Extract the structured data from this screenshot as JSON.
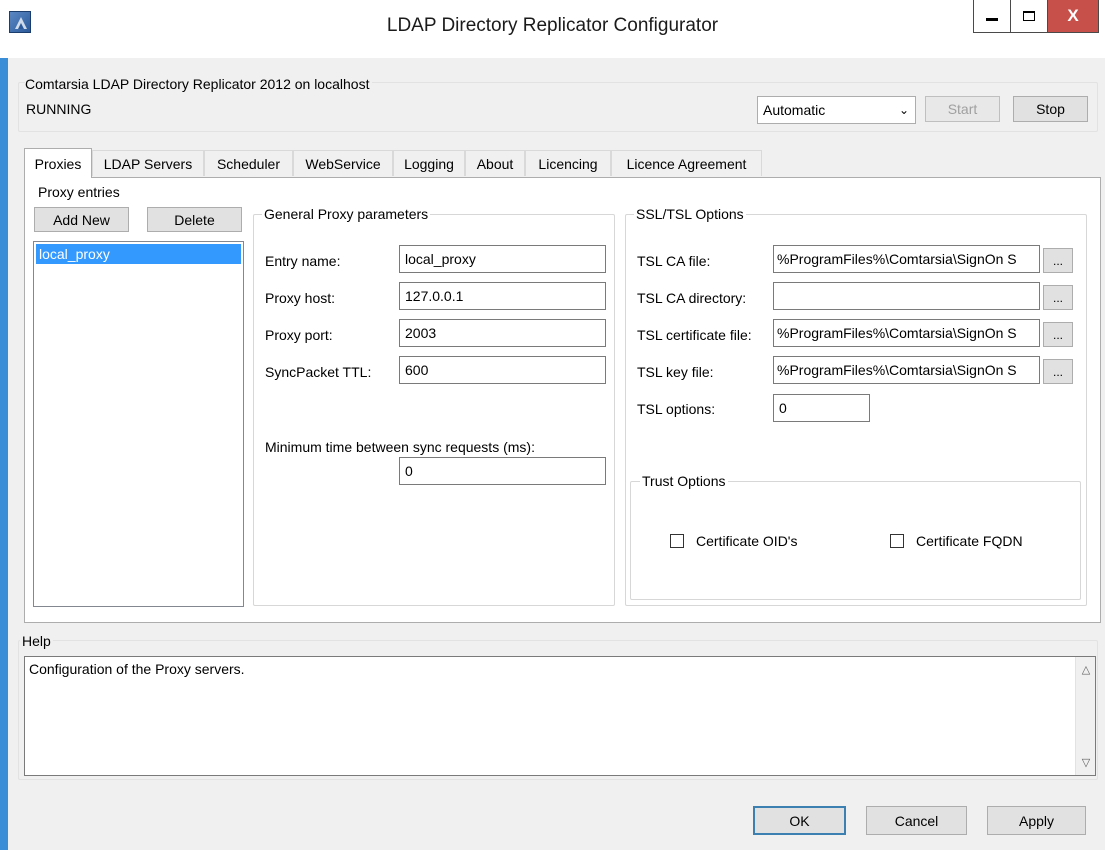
{
  "window": {
    "title": "LDAP Directory Replicator Configurator",
    "minimize_glyph": "—",
    "maximize_glyph": "☐",
    "close_glyph": "X"
  },
  "service": {
    "name": "Comtarsia LDAP Directory Replicator 2012 on localhost",
    "status": "RUNNING",
    "startup_mode": "Automatic",
    "start_label": "Start",
    "stop_label": "Stop"
  },
  "tabs": [
    "Proxies",
    "LDAP Servers",
    "Scheduler",
    "WebService",
    "Logging",
    "About",
    "Licencing",
    "Licence Agreement"
  ],
  "proxies": {
    "list_label": "Proxy entries",
    "add_label": "Add New",
    "delete_label": "Delete",
    "entries": [
      "local_proxy"
    ]
  },
  "general": {
    "title": "General Proxy parameters",
    "entry_name_label": "Entry name:",
    "entry_name_value": "local_proxy",
    "proxy_host_label": "Proxy host:",
    "proxy_host_value": "127.0.0.1",
    "proxy_port_label": "Proxy port:",
    "proxy_port_value": "2003",
    "ttl_label": "SyncPacket TTL:",
    "ttl_value": "600",
    "min_time_label": "Minimum time between sync requests (ms):",
    "min_time_value": "0"
  },
  "ssl": {
    "title": "SSL/TSL Options",
    "ca_file_label": "TSL CA file:",
    "ca_file_value": "%ProgramFiles%\\Comtarsia\\SignOn S",
    "ca_dir_label": "TSL CA directory:",
    "ca_dir_value": "",
    "cert_file_label": "TSL certificate file:",
    "cert_file_value": "%ProgramFiles%\\Comtarsia\\SignOn S",
    "key_file_label": "TSL key file:",
    "key_file_value": "%ProgramFiles%\\Comtarsia\\SignOn S",
    "options_label": "TSL options:",
    "options_value": "0",
    "browse_label": "...",
    "trust": {
      "title": "Trust Options",
      "oid_label": "Certificate OID's",
      "fqdn_label": "Certificate FQDN"
    }
  },
  "help": {
    "title": "Help",
    "text": "Configuration of the Proxy servers."
  },
  "footer": {
    "ok_label": "OK",
    "cancel_label": "Cancel",
    "apply_label": "Apply"
  },
  "colors": {
    "window_border": "#3a8ed8",
    "close_button": "#c7504a",
    "selection": "#3399ff"
  }
}
